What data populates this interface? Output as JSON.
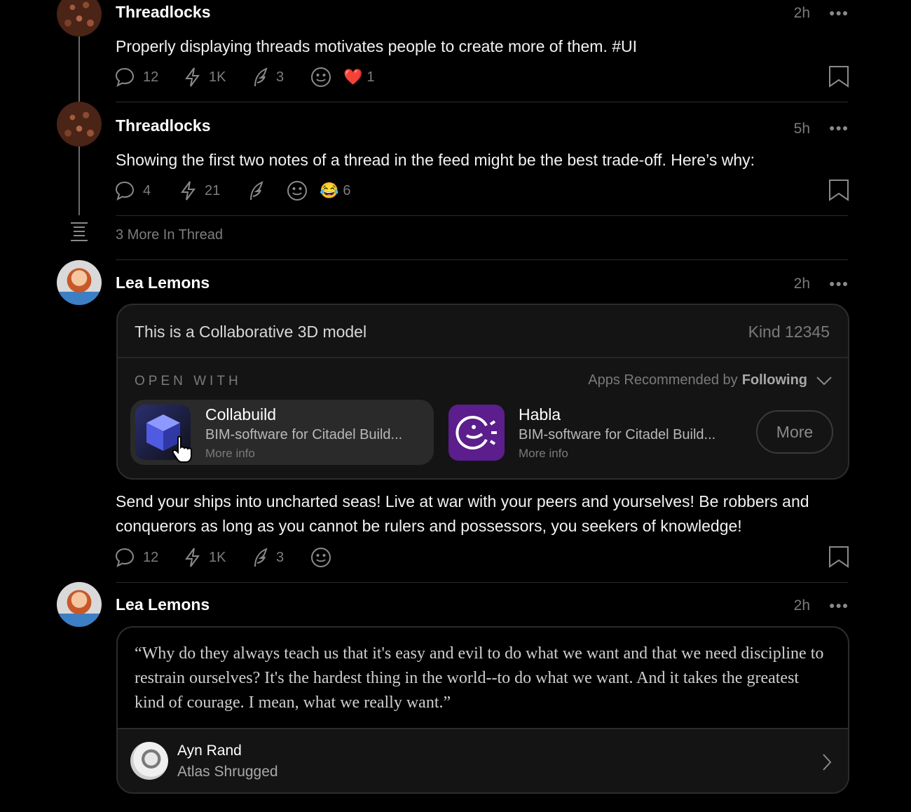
{
  "posts": [
    {
      "author": "Threadlocks",
      "time": "2h",
      "text": "Properly displaying threads motivates people to create more of them. #UI",
      "replies": "12",
      "zaps": "1K",
      "reposts": "3",
      "reaction_count": "1",
      "reaction_emoji": "❤️"
    },
    {
      "author": "Threadlocks",
      "time": "5h",
      "text": "Showing the first two notes of a thread in the feed might be the best trade-off. Here’s why:",
      "replies": "4",
      "zaps": "21",
      "reposts": "",
      "reaction_count": "6",
      "reaction_emoji": "😂"
    },
    {
      "author": "Lea Lemons",
      "time": "2h",
      "text": "Send your ships into uncharted seas! Live at war with your peers and yourselves! Be robbers and conquerors as long as you cannot be rulers and possessors, you seekers of knowledge!",
      "replies": "12",
      "zaps": "1K",
      "reposts": "3"
    },
    {
      "author": "Lea Lemons",
      "time": "2h"
    }
  ],
  "thread_more": "3 More In Thread",
  "app_card": {
    "title": "This is a Collaborative 3D model",
    "kind": "Kind 12345",
    "open_with": "OPEN WITH",
    "recommended_prefix": "Apps Recommended by",
    "recommended_source": "Following",
    "apps": [
      {
        "name": "Collabuild",
        "desc": "BIM-software for Citadel Build...",
        "more": "More info"
      },
      {
        "name": "Habla",
        "desc": "BIM-software for Citadel Build...",
        "more": "More info"
      }
    ],
    "more_button": "More"
  },
  "quote_card": {
    "quote": "“Why do they always teach us that it's easy and evil to do what we want and that we need discipline to restrain ourselves? It's the hardest thing in the world--to do what we want. And it takes the greatest kind of courage. I mean, what we really want.”",
    "author": "Ayn Rand",
    "source": "Atlas Shrugged"
  },
  "icons": {
    "reply": "speech-bubble-icon",
    "zap": "lightning-icon",
    "repost": "repost-feather-icon",
    "react": "smiley-icon",
    "bookmark": "bookmark-icon",
    "more": "ellipsis-icon",
    "thread": "thread-lines-icon",
    "chevron": "chevron-down-icon",
    "cursor": "hand-cursor-icon"
  },
  "colors": {
    "background": "#000000",
    "card": "#141414",
    "muted": "#7a7a7a",
    "habla": "#5b1e8c",
    "collabuild": "#4f5be0"
  }
}
